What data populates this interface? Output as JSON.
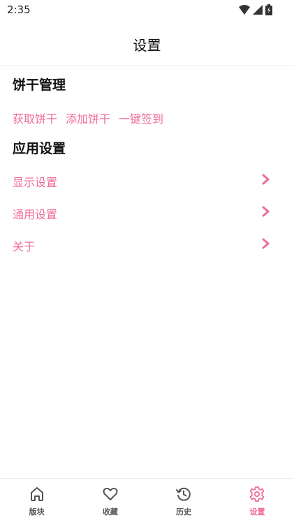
{
  "status_bar": {
    "time": "2:35"
  },
  "app_bar": {
    "title": "设置"
  },
  "cookie_section": {
    "title": "饼干管理",
    "actions": [
      "获取饼干",
      "添加饼干",
      "一键签到"
    ]
  },
  "app_section": {
    "title": "应用设置",
    "items": [
      {
        "label": "显示设置",
        "icon": "chevron-right-icon"
      },
      {
        "label": "通用设置",
        "icon": "chevron-right-icon"
      },
      {
        "label": "关于",
        "icon": "chevron-right-icon"
      }
    ]
  },
  "bottom_nav": {
    "items": [
      {
        "label": "版块",
        "icon": "home-icon"
      },
      {
        "label": "收藏",
        "icon": "heart-icon"
      },
      {
        "label": "历史",
        "icon": "history-icon"
      },
      {
        "label": "设置",
        "icon": "gear-icon"
      }
    ],
    "active_index": 3
  },
  "colors": {
    "accent": "#f06d96",
    "text": "#111111",
    "nav_inactive": "#555555"
  }
}
